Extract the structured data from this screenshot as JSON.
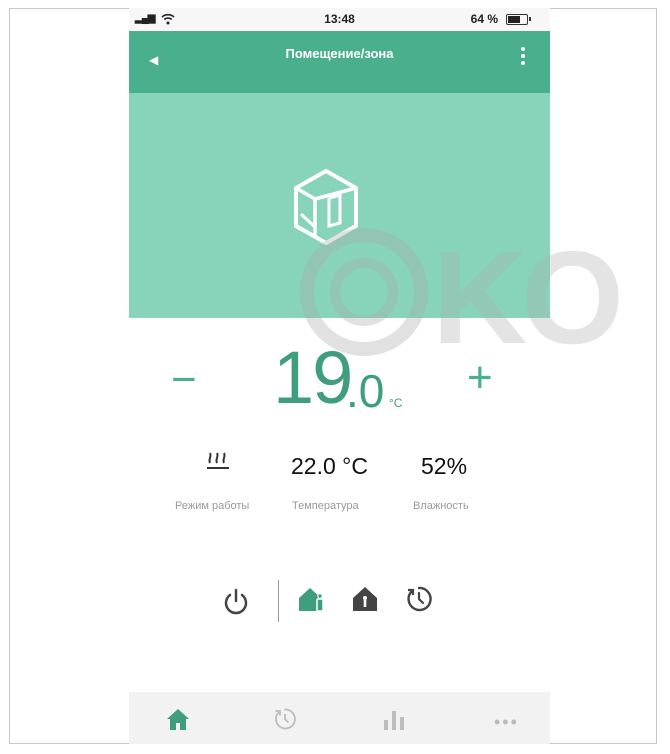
{
  "status_bar": {
    "time": "13:48",
    "battery": "64 %",
    "battery_level": 0.64
  },
  "app_bar": {
    "title": "Помещение/зона"
  },
  "setpoint": {
    "whole": "19",
    "decimal": ".0",
    "unit": "°C",
    "minus_label": "−",
    "plus_label": "+"
  },
  "stats": {
    "mode": {
      "icon": "heating-icon",
      "label": "Режим работы"
    },
    "temperature": {
      "value": "22.0 °C",
      "label": "Температура"
    },
    "humidity": {
      "value": "52%",
      "label": "Влажность"
    }
  },
  "controls": {
    "items": [
      {
        "icon": "power-icon"
      },
      {
        "icon": "home-info-icon",
        "active": true
      },
      {
        "icon": "home-lock-icon"
      },
      {
        "icon": "schedule-icon"
      }
    ]
  },
  "bottom_nav": {
    "items": [
      {
        "icon": "home-icon",
        "active": true
      },
      {
        "icon": "schedule-icon"
      },
      {
        "icon": "chart-icon"
      },
      {
        "icon": "more-icon",
        "label": "•••"
      }
    ]
  },
  "watermark": {
    "text": "KO"
  },
  "colors": {
    "accent": "#4aaf8d",
    "hero": "#88d4bb",
    "accent_dark": "#3e9e7e"
  }
}
